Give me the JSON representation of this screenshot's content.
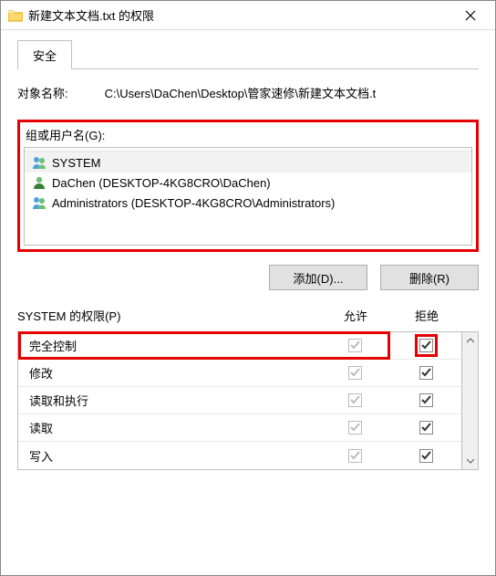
{
  "window": {
    "title": "新建文本文档.txt 的权限"
  },
  "tab": {
    "security": "安全"
  },
  "object": {
    "label": "对象名称:",
    "path": "C:\\Users\\DaChen\\Desktop\\管家速修\\新建文本文档.t"
  },
  "groupLabel": "组或用户名(G):",
  "users": [
    {
      "name": "SYSTEM"
    },
    {
      "name": "DaChen (DESKTOP-4KG8CRO\\DaChen)"
    },
    {
      "name": "Administrators (DESKTOP-4KG8CRO\\Administrators)"
    }
  ],
  "buttons": {
    "add": "添加(D)...",
    "remove": "删除(R)"
  },
  "permHeader": {
    "label": "SYSTEM 的权限(P)",
    "allow": "允许",
    "deny": "拒绝"
  },
  "permissions": [
    {
      "label": "完全控制",
      "allow": true,
      "deny": true,
      "allowDim": true,
      "highlightRow": true,
      "highlightDeny": true
    },
    {
      "label": "修改",
      "allow": true,
      "deny": true,
      "allowDim": true
    },
    {
      "label": "读取和执行",
      "allow": true,
      "deny": true,
      "allowDim": true
    },
    {
      "label": "读取",
      "allow": true,
      "deny": true,
      "allowDim": true
    },
    {
      "label": "写入",
      "allow": true,
      "deny": true,
      "allowDim": true
    }
  ]
}
